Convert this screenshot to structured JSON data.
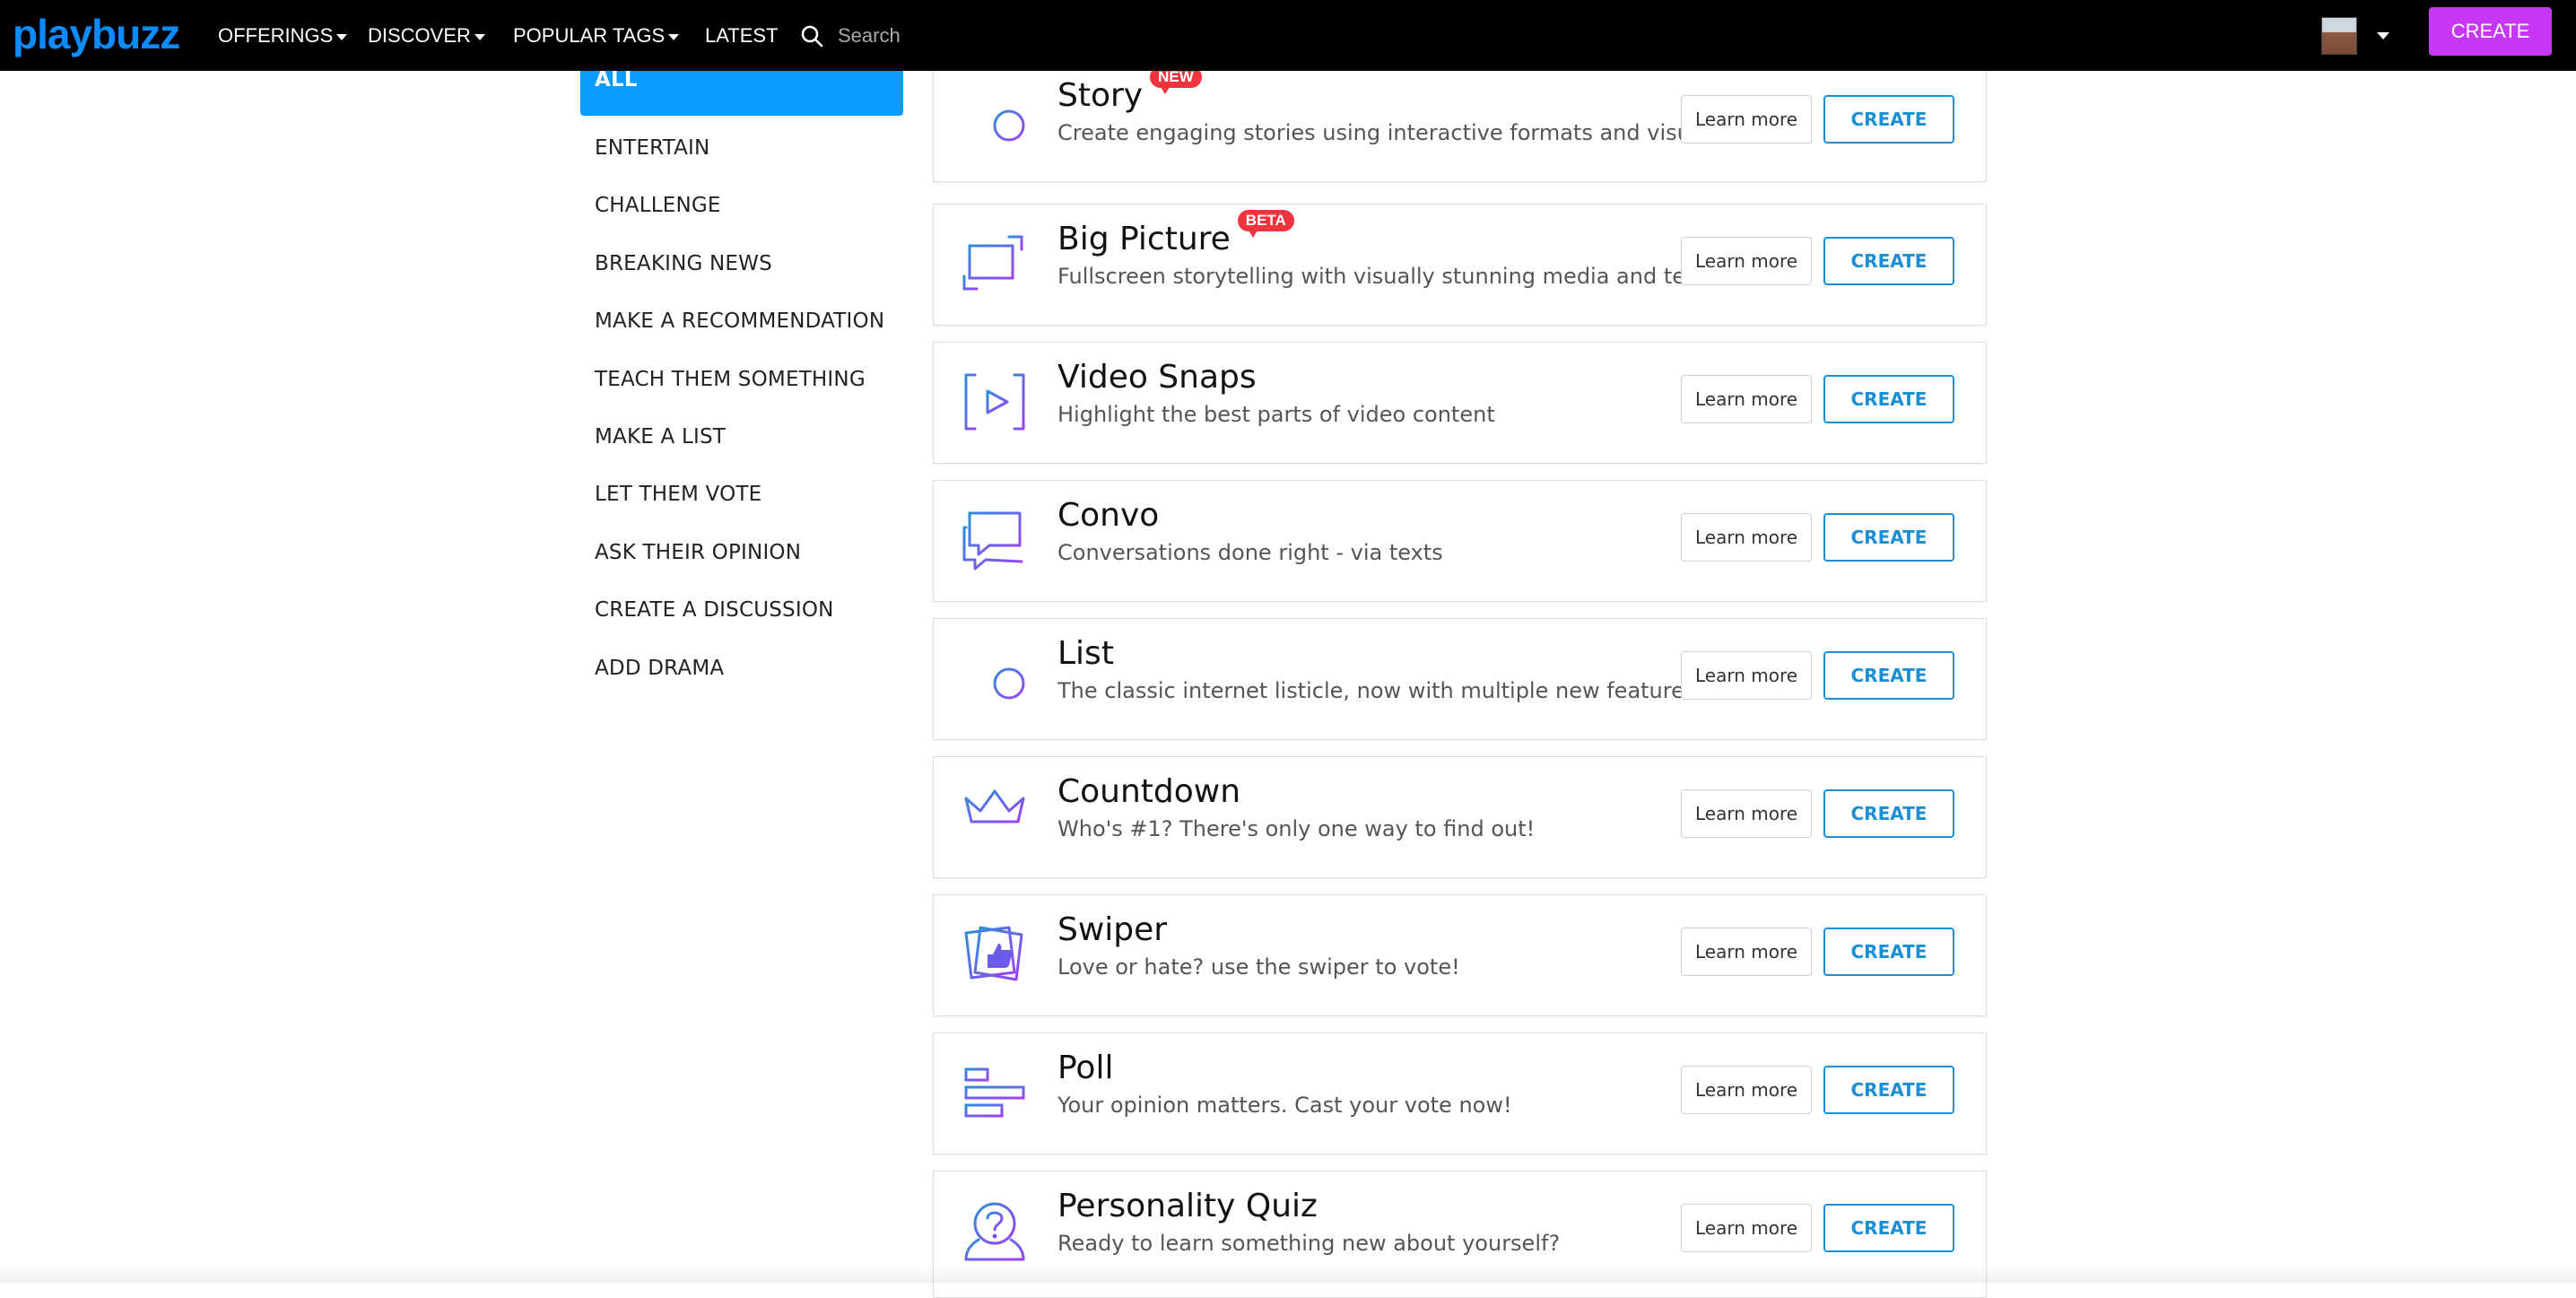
{
  "nav": {
    "logo": "playbuzz",
    "items": [
      {
        "label": "OFFERINGS",
        "dropdown": true
      },
      {
        "label": "DISCOVER",
        "dropdown": true
      },
      {
        "label": "POPULAR TAGS",
        "dropdown": true
      },
      {
        "label": "LATEST",
        "dropdown": false
      }
    ],
    "search_placeholder": "Search",
    "create_label": "CREATE"
  },
  "sidebar": {
    "items": [
      {
        "label": "ALL",
        "active": true
      },
      {
        "label": "ENTERTAIN"
      },
      {
        "label": "CHALLENGE"
      },
      {
        "label": "BREAKING NEWS"
      },
      {
        "label": "MAKE A RECOMMENDATION"
      },
      {
        "label": "TEACH THEM SOMETHING"
      },
      {
        "label": "MAKE A LIST"
      },
      {
        "label": "LET THEM VOTE"
      },
      {
        "label": "ASK THEIR OPINION"
      },
      {
        "label": "CREATE A DISCUSSION"
      },
      {
        "label": "ADD DRAMA"
      }
    ]
  },
  "cards": [
    {
      "title": "Story",
      "badge": "NEW",
      "description": "Create engaging stories using interactive formats and visuals.",
      "icon": "list-plus-icon",
      "learn": "Learn more",
      "create": "CREATE"
    },
    {
      "title": "Big Picture",
      "badge": "BETA",
      "description": "Fullscreen storytelling with visually stunning media and text",
      "icon": "big-picture-icon",
      "learn": "Learn more",
      "create": "CREATE"
    },
    {
      "title": "Video Snaps",
      "badge": "",
      "description": "Highlight the best parts of video content",
      "icon": "video-play-icon",
      "learn": "Learn more",
      "create": "CREATE"
    },
    {
      "title": "Convo",
      "badge": "",
      "description": "Conversations done right - via texts",
      "icon": "chat-bubbles-icon",
      "learn": "Learn more",
      "create": "CREATE"
    },
    {
      "title": "List",
      "badge": "",
      "description": "The classic internet listicle, now with multiple new features!",
      "icon": "list-plus-icon",
      "learn": "Learn more",
      "create": "CREATE"
    },
    {
      "title": "Countdown",
      "badge": "",
      "description": "Who's #1? There's only one way to find out!",
      "icon": "crown-icon",
      "learn": "Learn more",
      "create": "CREATE"
    },
    {
      "title": "Swiper",
      "badge": "",
      "description": "Love or hate? use the swiper to vote!",
      "icon": "thumbs-up-cards-icon",
      "learn": "Learn more",
      "create": "CREATE"
    },
    {
      "title": "Poll",
      "badge": "",
      "description": "Your opinion matters. Cast your vote now!",
      "icon": "poll-bars-icon",
      "learn": "Learn more",
      "create": "CREATE"
    },
    {
      "title": "Personality Quiz",
      "badge": "",
      "description": "Ready to learn something new about yourself?",
      "icon": "question-person-icon",
      "learn": "Learn more",
      "create": "CREATE"
    }
  ],
  "colors": {
    "brand_blue": "#0a8cff",
    "create_purple": "#c738f6",
    "active_tab": "#0a9bff",
    "create_outline": "#1a8fd6",
    "badge_red": "#f0343f",
    "icon_gradient_start": "#2b8fd8",
    "icon_gradient_end": "#a13ff5"
  }
}
